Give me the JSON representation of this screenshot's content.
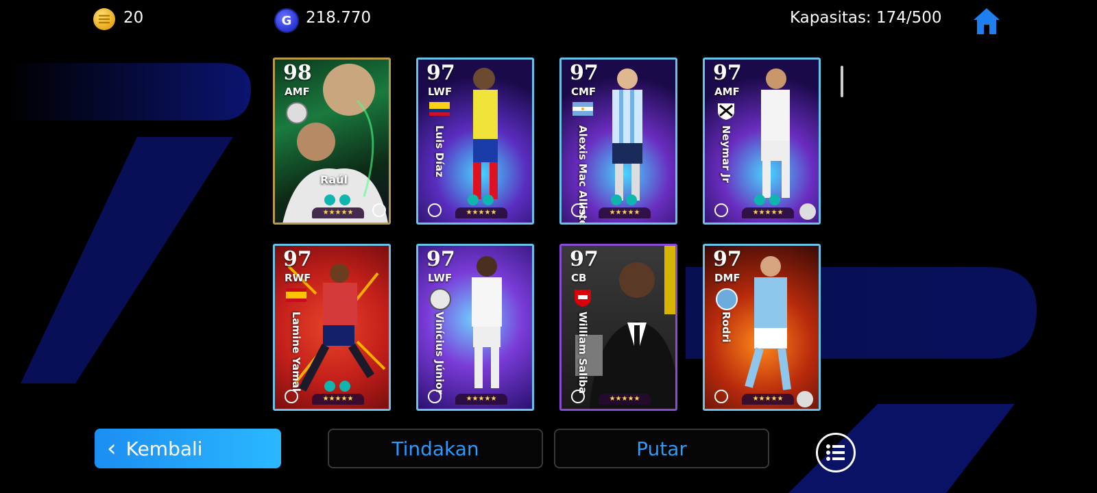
{
  "header": {
    "efootball_coins": "20",
    "gp": "218.770",
    "capacity_label": "Kapasitas: 174/500"
  },
  "cards": [
    {
      "rating": "98",
      "position": "AMF",
      "name": "Raúl",
      "name_orientation": "horizontal",
      "stars": "★★★★★",
      "theme": "green"
    },
    {
      "rating": "97",
      "position": "LWF",
      "name": "Luis Díaz",
      "name_orientation": "vertical",
      "stars": "★★★★★",
      "theme": "purple"
    },
    {
      "rating": "97",
      "position": "CMF",
      "name": "Alexis Mac Allister",
      "name_orientation": "vertical",
      "stars": "★★★★★",
      "theme": "purple"
    },
    {
      "rating": "97",
      "position": "AMF",
      "name": "Neymar Jr",
      "name_orientation": "vertical",
      "stars": "★★★★★",
      "theme": "purple"
    },
    {
      "rating": "97",
      "position": "RWF",
      "name": "Lamine Yamal",
      "name_orientation": "vertical",
      "stars": "★★★★★",
      "theme": "red"
    },
    {
      "rating": "97",
      "position": "LWF",
      "name": "Vinícius Júnior",
      "name_orientation": "vertical",
      "stars": "★★★★★",
      "theme": "blue"
    },
    {
      "rating": "97",
      "position": "CB",
      "name": "William Saliba",
      "name_orientation": "vertical",
      "stars": "★★★★★",
      "theme": "dark"
    },
    {
      "rating": "97",
      "position": "DMF",
      "name": "Rodri",
      "name_orientation": "vertical",
      "stars": "★★★★★",
      "theme": "fire"
    }
  ],
  "footer": {
    "back_label": "Kembali",
    "action_label": "Tindakan",
    "spin_label": "Putar"
  },
  "colors": {
    "accent": "#2a9bff",
    "back_button": "#1c8ef2"
  },
  "icons": {
    "coin": "efootball-coin-icon",
    "gp": "gp-coin-icon",
    "home": "home-icon",
    "menu": "list-menu-icon"
  }
}
